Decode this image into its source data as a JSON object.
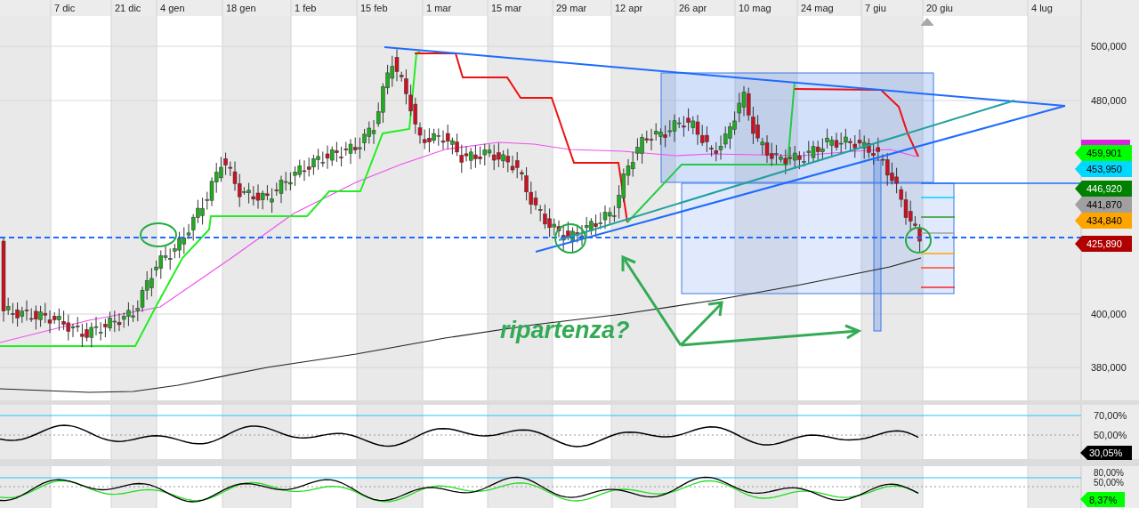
{
  "time_axis": {
    "labels": [
      "7 dic",
      "21 dic",
      "4 gen",
      "18 gen",
      "1 feb",
      "15 feb",
      "1 mar",
      "15 mar",
      "29 mar",
      "12 apr",
      "26 apr",
      "10 mag",
      "24 mag",
      "7 giu",
      "20 giu",
      "4 lug"
    ]
  },
  "price_axis": {
    "ticks": [
      "500,000",
      "480,000",
      "400,000",
      "380,000"
    ]
  },
  "price_tags": [
    {
      "text": "459,901",
      "color": "#00ff00"
    },
    {
      "text": "453,950",
      "color": "#00d8ff"
    },
    {
      "text": "446,920",
      "color": "#008000"
    },
    {
      "text": "441,870",
      "color": "#a0a0a0"
    },
    {
      "text": "434,840",
      "color": "#ffa500"
    },
    {
      "text": "425,890",
      "color": "#b00000"
    }
  ],
  "annotation": "ripartenza?",
  "oscillator_1": {
    "ticks": [
      "70,00%",
      "50,00%"
    ],
    "tag": {
      "text": "30,05%",
      "color": "#000000"
    }
  },
  "oscillator_2": {
    "ticks": [
      "80,00%",
      "50,00%"
    ],
    "tag": {
      "text": "8,37%",
      "color": "#00ff00"
    }
  }
}
